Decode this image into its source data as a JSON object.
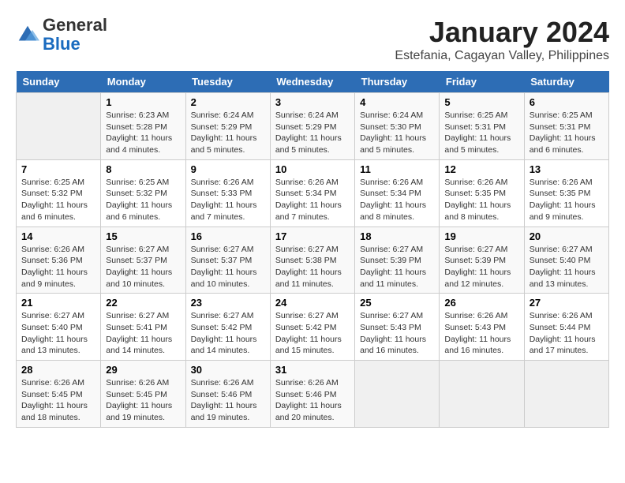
{
  "header": {
    "logo_general": "General",
    "logo_blue": "Blue",
    "month_year": "January 2024",
    "location": "Estefania, Cagayan Valley, Philippines"
  },
  "calendar": {
    "days_of_week": [
      "Sunday",
      "Monday",
      "Tuesday",
      "Wednesday",
      "Thursday",
      "Friday",
      "Saturday"
    ],
    "weeks": [
      [
        {
          "day": "",
          "sunrise": "",
          "sunset": "",
          "daylight": ""
        },
        {
          "day": "1",
          "sunrise": "Sunrise: 6:23 AM",
          "sunset": "Sunset: 5:28 PM",
          "daylight": "Daylight: 11 hours and 4 minutes."
        },
        {
          "day": "2",
          "sunrise": "Sunrise: 6:24 AM",
          "sunset": "Sunset: 5:29 PM",
          "daylight": "Daylight: 11 hours and 5 minutes."
        },
        {
          "day": "3",
          "sunrise": "Sunrise: 6:24 AM",
          "sunset": "Sunset: 5:29 PM",
          "daylight": "Daylight: 11 hours and 5 minutes."
        },
        {
          "day": "4",
          "sunrise": "Sunrise: 6:24 AM",
          "sunset": "Sunset: 5:30 PM",
          "daylight": "Daylight: 11 hours and 5 minutes."
        },
        {
          "day": "5",
          "sunrise": "Sunrise: 6:25 AM",
          "sunset": "Sunset: 5:31 PM",
          "daylight": "Daylight: 11 hours and 5 minutes."
        },
        {
          "day": "6",
          "sunrise": "Sunrise: 6:25 AM",
          "sunset": "Sunset: 5:31 PM",
          "daylight": "Daylight: 11 hours and 6 minutes."
        }
      ],
      [
        {
          "day": "7",
          "sunrise": "Sunrise: 6:25 AM",
          "sunset": "Sunset: 5:32 PM",
          "daylight": "Daylight: 11 hours and 6 minutes."
        },
        {
          "day": "8",
          "sunrise": "Sunrise: 6:25 AM",
          "sunset": "Sunset: 5:32 PM",
          "daylight": "Daylight: 11 hours and 6 minutes."
        },
        {
          "day": "9",
          "sunrise": "Sunrise: 6:26 AM",
          "sunset": "Sunset: 5:33 PM",
          "daylight": "Daylight: 11 hours and 7 minutes."
        },
        {
          "day": "10",
          "sunrise": "Sunrise: 6:26 AM",
          "sunset": "Sunset: 5:34 PM",
          "daylight": "Daylight: 11 hours and 7 minutes."
        },
        {
          "day": "11",
          "sunrise": "Sunrise: 6:26 AM",
          "sunset": "Sunset: 5:34 PM",
          "daylight": "Daylight: 11 hours and 8 minutes."
        },
        {
          "day": "12",
          "sunrise": "Sunrise: 6:26 AM",
          "sunset": "Sunset: 5:35 PM",
          "daylight": "Daylight: 11 hours and 8 minutes."
        },
        {
          "day": "13",
          "sunrise": "Sunrise: 6:26 AM",
          "sunset": "Sunset: 5:35 PM",
          "daylight": "Daylight: 11 hours and 9 minutes."
        }
      ],
      [
        {
          "day": "14",
          "sunrise": "Sunrise: 6:26 AM",
          "sunset": "Sunset: 5:36 PM",
          "daylight": "Daylight: 11 hours and 9 minutes."
        },
        {
          "day": "15",
          "sunrise": "Sunrise: 6:27 AM",
          "sunset": "Sunset: 5:37 PM",
          "daylight": "Daylight: 11 hours and 10 minutes."
        },
        {
          "day": "16",
          "sunrise": "Sunrise: 6:27 AM",
          "sunset": "Sunset: 5:37 PM",
          "daylight": "Daylight: 11 hours and 10 minutes."
        },
        {
          "day": "17",
          "sunrise": "Sunrise: 6:27 AM",
          "sunset": "Sunset: 5:38 PM",
          "daylight": "Daylight: 11 hours and 11 minutes."
        },
        {
          "day": "18",
          "sunrise": "Sunrise: 6:27 AM",
          "sunset": "Sunset: 5:39 PM",
          "daylight": "Daylight: 11 hours and 11 minutes."
        },
        {
          "day": "19",
          "sunrise": "Sunrise: 6:27 AM",
          "sunset": "Sunset: 5:39 PM",
          "daylight": "Daylight: 11 hours and 12 minutes."
        },
        {
          "day": "20",
          "sunrise": "Sunrise: 6:27 AM",
          "sunset": "Sunset: 5:40 PM",
          "daylight": "Daylight: 11 hours and 13 minutes."
        }
      ],
      [
        {
          "day": "21",
          "sunrise": "Sunrise: 6:27 AM",
          "sunset": "Sunset: 5:40 PM",
          "daylight": "Daylight: 11 hours and 13 minutes."
        },
        {
          "day": "22",
          "sunrise": "Sunrise: 6:27 AM",
          "sunset": "Sunset: 5:41 PM",
          "daylight": "Daylight: 11 hours and 14 minutes."
        },
        {
          "day": "23",
          "sunrise": "Sunrise: 6:27 AM",
          "sunset": "Sunset: 5:42 PM",
          "daylight": "Daylight: 11 hours and 14 minutes."
        },
        {
          "day": "24",
          "sunrise": "Sunrise: 6:27 AM",
          "sunset": "Sunset: 5:42 PM",
          "daylight": "Daylight: 11 hours and 15 minutes."
        },
        {
          "day": "25",
          "sunrise": "Sunrise: 6:27 AM",
          "sunset": "Sunset: 5:43 PM",
          "daylight": "Daylight: 11 hours and 16 minutes."
        },
        {
          "day": "26",
          "sunrise": "Sunrise: 6:26 AM",
          "sunset": "Sunset: 5:43 PM",
          "daylight": "Daylight: 11 hours and 16 minutes."
        },
        {
          "day": "27",
          "sunrise": "Sunrise: 6:26 AM",
          "sunset": "Sunset: 5:44 PM",
          "daylight": "Daylight: 11 hours and 17 minutes."
        }
      ],
      [
        {
          "day": "28",
          "sunrise": "Sunrise: 6:26 AM",
          "sunset": "Sunset: 5:45 PM",
          "daylight": "Daylight: 11 hours and 18 minutes."
        },
        {
          "day": "29",
          "sunrise": "Sunrise: 6:26 AM",
          "sunset": "Sunset: 5:45 PM",
          "daylight": "Daylight: 11 hours and 19 minutes."
        },
        {
          "day": "30",
          "sunrise": "Sunrise: 6:26 AM",
          "sunset": "Sunset: 5:46 PM",
          "daylight": "Daylight: 11 hours and 19 minutes."
        },
        {
          "day": "31",
          "sunrise": "Sunrise: 6:26 AM",
          "sunset": "Sunset: 5:46 PM",
          "daylight": "Daylight: 11 hours and 20 minutes."
        },
        {
          "day": "",
          "sunrise": "",
          "sunset": "",
          "daylight": ""
        },
        {
          "day": "",
          "sunrise": "",
          "sunset": "",
          "daylight": ""
        },
        {
          "day": "",
          "sunrise": "",
          "sunset": "",
          "daylight": ""
        }
      ]
    ]
  }
}
